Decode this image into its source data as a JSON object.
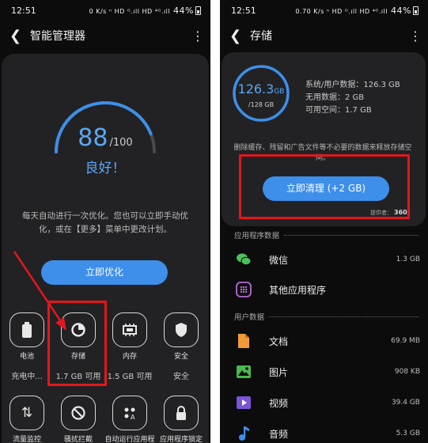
{
  "left": {
    "status": {
      "time": "12:51",
      "icons": "0 K/s ⁿ HD ᴳ.ıll HD ⁴ᴳ.ıll",
      "battery": "44%"
    },
    "title": "智能管理器",
    "score": {
      "value": "88",
      "max": "/100",
      "fraction": 0.88,
      "verdict": "良好！"
    },
    "description": "每天自动进行一次优化。您也可以立即手动优化，或在【更多】菜单中更改计划。",
    "optimize_label": "立即优化",
    "tiles": [
      {
        "label": "电池",
        "sub": "充电中..."
      },
      {
        "label": "存储",
        "sub": "1.7 GB 可用"
      },
      {
        "label": "内存",
        "sub": "1.5 GB 可用"
      },
      {
        "label": "安全",
        "sub": "安全"
      }
    ],
    "tiles2": [
      {
        "label": "流量监控"
      },
      {
        "label": "骚扰拦截"
      },
      {
        "label": "自动运行应用程"
      },
      {
        "label": "应用程序锁定"
      }
    ]
  },
  "right": {
    "status": {
      "time": "12:51",
      "icons": "0.70 K/s ⁿ HD ᴳ.ıll HD ⁴ᴳ.ıll",
      "battery": "44%"
    },
    "title": "存储",
    "used": "126.3",
    "used_unit": "GB",
    "total": "/128 GB",
    "fraction": 0.987,
    "stats": [
      "系统/用户数据：126.3 GB",
      "无用数据：2 GB",
      "可用空间：1.7 GB"
    ],
    "note": "删除缓存、残留和广告文件等不必要的数据来释放存储空间。",
    "clean_label": "立即清理 (+2 GB)",
    "provider_label": "提供者：",
    "provider_name": "360",
    "sections": {
      "apps": "应用程序数据",
      "user": "用户数据"
    },
    "apps": [
      {
        "name": "微信",
        "size": "1.3 GB"
      },
      {
        "name": "其他应用程序",
        "size": ""
      }
    ],
    "user": [
      {
        "name": "文档",
        "size": "69.9 MB"
      },
      {
        "name": "图片",
        "size": "908 KB"
      },
      {
        "name": "视频",
        "size": "39.4 GB"
      },
      {
        "name": "音频",
        "size": "5.3 GB"
      }
    ],
    "colors": {
      "accent": "#3d8fea",
      "highlight": "#e3171c"
    }
  }
}
